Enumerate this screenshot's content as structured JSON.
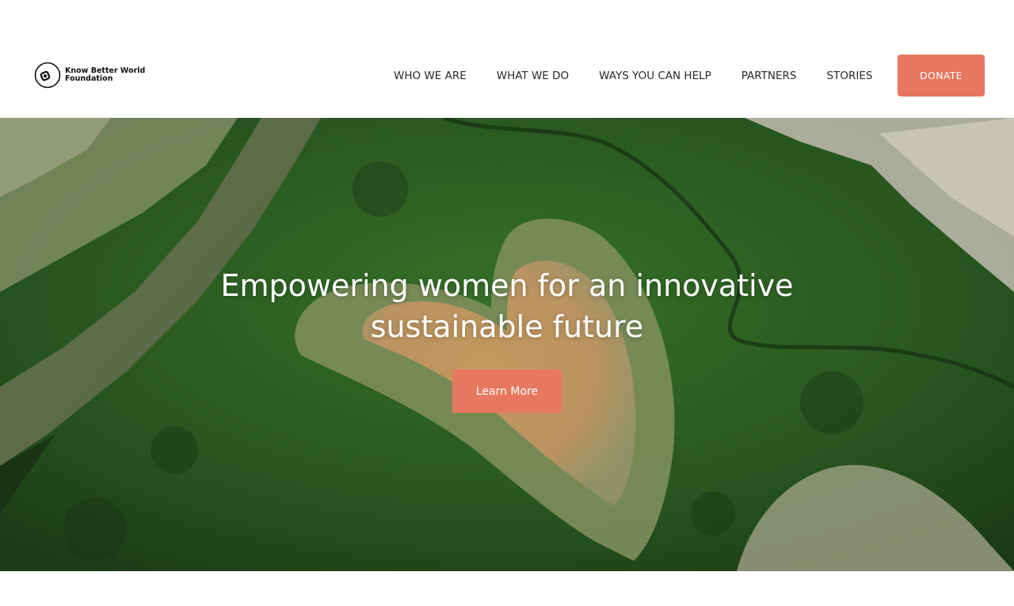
{
  "brand": {
    "name_line1": "Know Better World",
    "name_line2": "Foundation"
  },
  "nav": {
    "items": [
      {
        "label": "WHO WE ARE"
      },
      {
        "label": "WHAT WE DO"
      },
      {
        "label": "WAYS YOU CAN HELP"
      },
      {
        "label": "PARTNERS"
      },
      {
        "label": "STORIES"
      }
    ],
    "donate_label": "DONATE"
  },
  "hero": {
    "title_line1": "Empowering women for an innovative",
    "title_line2": "sustainable future",
    "cta_label": "Learn More",
    "image_subject": "aerial view of heart-shaped clearing in mangrove forest"
  },
  "colors": {
    "accent": "#e8775f",
    "text_dark": "#2a2a2a",
    "background": "#ffffff"
  }
}
